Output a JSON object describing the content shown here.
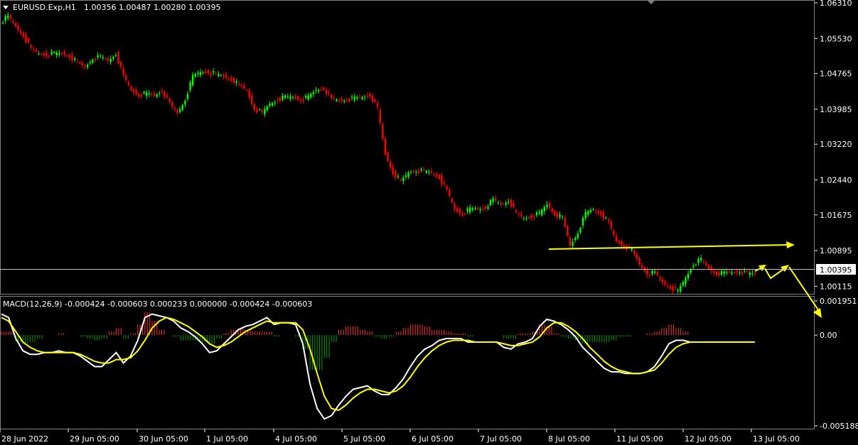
{
  "header": {
    "symbol": "EURUSD.Exp,H1",
    "ohlc": "1.00356 1.00487 1.00280 1.00395"
  },
  "indicator": {
    "label": "MACD(12,26,9) -0.000424 -0.000603 0.000233 0.000000 -0.000424 -0.000603"
  },
  "current_price": "1.00395",
  "colors": {
    "background": "#000000",
    "bull": "#00ff00",
    "bear": "#ff0000",
    "macd_line": "#ffffff",
    "signal_line": "#ffff00",
    "hist_pos": "#ff3030",
    "hist_neg": "#00a000",
    "annotation": "#ffff00",
    "grid": "#808080"
  },
  "chart_data": [
    {
      "type": "candlestick",
      "x_ticks": [
        "28 Jun 2022",
        "29 Jun 05:00",
        "30 Jun 05:00",
        "1 Jul 05:00",
        "4 Jul 05:00",
        "5 Jul 05:00",
        "6 Jul 05:00",
        "7 Jul 05:00",
        "8 Jul 05:00",
        "11 Jul 05:00",
        "12 Jul 05:00",
        "13 Jul 05:00"
      ],
      "y_ticks": [
        "1.06310",
        "1.05530",
        "1.04765",
        "1.03985",
        "1.03220",
        "1.02440",
        "1.01675",
        "1.00895",
        "1.00115"
      ],
      "ylim": [
        0.9995,
        1.0631
      ],
      "close_path": [
        1.059,
        1.06,
        1.058,
        1.056,
        1.053,
        1.052,
        1.0518,
        1.052,
        1.052,
        1.0515,
        1.05,
        1.049,
        1.051,
        1.0512,
        1.0505,
        1.052,
        1.047,
        1.044,
        1.043,
        1.0432,
        1.0428,
        1.044,
        1.041,
        1.039,
        1.042,
        1.047,
        1.048,
        1.048,
        1.0475,
        1.047,
        1.0465,
        1.045,
        1.044,
        1.04,
        1.039,
        1.041,
        1.042,
        1.0425,
        1.0425,
        1.042,
        1.0425,
        1.044,
        1.0445,
        1.042,
        1.0418,
        1.042,
        1.0422,
        1.0425,
        1.043,
        1.04,
        1.03,
        1.026,
        1.024,
        1.026,
        1.0265,
        1.0262,
        1.026,
        1.025,
        1.022,
        1.018,
        1.017,
        1.018,
        1.018,
        1.0185,
        1.02,
        1.019,
        1.02,
        1.017,
        1.016,
        1.0165,
        1.017,
        1.019,
        1.017,
        1.016,
        1.01,
        1.013,
        1.017,
        1.018,
        1.017,
        1.015,
        1.011,
        1.01,
        1.009,
        1.006,
        1.004,
        1.004,
        1.002,
        1.001,
        1.0,
        1.003,
        1.006,
        1.007,
        1.005,
        1.004,
        1.004,
        1.0042,
        1.0045,
        1.0039
      ]
    },
    {
      "type": "line",
      "name": "MACD(12,26,9)",
      "y_ticks": [
        "0.001951",
        "0.00",
        "-0.005188"
      ],
      "ylim": [
        -0.005188,
        0.001951
      ],
      "x_count": 106,
      "series": [
        {
          "values": [
            0.0012,
            0.001,
            -0.0002,
            -0.0009,
            -0.0011,
            -0.0011,
            -0.001,
            -0.001,
            -0.0009,
            -0.001,
            -0.001,
            -0.0012,
            -0.0015,
            -0.0018,
            -0.0018,
            -0.0014,
            -0.001,
            -0.0016,
            -0.0012,
            -0.0003,
            0.001,
            0.0012,
            0.0011,
            0.001,
            0.0008,
            0.0004,
            0.0002,
            -0.0001,
            -0.0005,
            -0.001,
            -0.0009,
            -0.0005,
            -0.0001,
            0.0003,
            0.0005,
            0.0006,
            0.0008,
            0.001,
            0.0006,
            0.0007,
            0.0007,
            0.0006,
            -0.0005,
            -0.0028,
            -0.0042,
            -0.0048,
            -0.0046,
            -0.004,
            -0.0035,
            -0.0031,
            -0.003,
            -0.0029,
            -0.0032,
            -0.0034,
            -0.0034,
            -0.003,
            -0.0025,
            -0.0018,
            -0.0012,
            -0.0008,
            -0.0006,
            -0.0003,
            -0.0002,
            -0.0002,
            -0.0002,
            -0.0004,
            -0.0004,
            -0.0004,
            -0.0004,
            -0.0004,
            -0.0007,
            -0.0008,
            -0.0005,
            -0.0004,
            -0.0002,
            0.0005,
            0.0009,
            0.0008,
            0.0006,
            0.0003,
            -0.0001,
            -0.0007,
            -0.0011,
            -0.0015,
            -0.0019,
            -0.0021,
            -0.0021,
            -0.0022,
            -0.0022,
            -0.0022,
            -0.0021,
            -0.0018,
            -0.0012,
            -0.0005,
            -0.0003,
            -0.0003,
            -0.0004,
            -0.0004,
            -0.0004,
            -0.0004,
            -0.0004,
            -0.0004,
            -0.0004,
            -0.0004,
            -0.0004,
            -0.0004
          ]
        },
        {
          "values": [
            0.001,
            0.0008,
            0.0002,
            -0.0004,
            -0.0007,
            -0.0009,
            -0.001,
            -0.001,
            -0.001,
            -0.001,
            -0.001,
            -0.0011,
            -0.0013,
            -0.0015,
            -0.0016,
            -0.0016,
            -0.0014,
            -0.0014,
            -0.0013,
            -0.0009,
            -0.0003,
            0.0004,
            0.0008,
            0.001,
            0.0009,
            0.0007,
            0.0005,
            0.0002,
            -0.0001,
            -0.0005,
            -0.0007,
            -0.0006,
            -0.0004,
            -0.0001,
            0.0002,
            0.0004,
            0.0006,
            0.0008,
            0.0007,
            0.0007,
            0.0007,
            0.0007,
            0.0003,
            -0.0008,
            -0.0022,
            -0.0035,
            -0.0042,
            -0.0043,
            -0.004,
            -0.0036,
            -0.0033,
            -0.0031,
            -0.0031,
            -0.0032,
            -0.0033,
            -0.0032,
            -0.0029,
            -0.0024,
            -0.0018,
            -0.0013,
            -0.0009,
            -0.0006,
            -0.0004,
            -0.0003,
            -0.0003,
            -0.0003,
            -0.0004,
            -0.0004,
            -0.0004,
            -0.0004,
            -0.0005,
            -0.0006,
            -0.0006,
            -0.0005,
            -0.0004,
            -0.0001,
            0.0004,
            0.0007,
            0.0007,
            0.0005,
            0.0002,
            -0.0002,
            -0.0007,
            -0.0011,
            -0.0015,
            -0.0018,
            -0.002,
            -0.0021,
            -0.0022,
            -0.0022,
            -0.0021,
            -0.002,
            -0.0016,
            -0.0011,
            -0.0007,
            -0.0005,
            -0.0004,
            -0.0004,
            -0.0004,
            -0.0004,
            -0.0004,
            -0.0004,
            -0.0004,
            -0.0004,
            -0.0004,
            -0.0004
          ]
        }
      ],
      "histogram": [
        0.0002,
        0.0002,
        -0.0004,
        -0.0005,
        -0.0004,
        -0.0002,
        0.0,
        0.0,
        0.0001,
        0.0,
        0.0,
        -0.0001,
        -0.0002,
        -0.0003,
        -0.0002,
        0.0002,
        0.0004,
        -0.0002,
        0.0001,
        0.0006,
        0.0013,
        0.0008,
        0.0003,
        0.0,
        -0.0001,
        -0.0003,
        -0.0003,
        -0.0003,
        -0.0004,
        -0.0005,
        -0.0002,
        0.0001,
        0.0003,
        0.0004,
        0.0003,
        0.0002,
        0.0002,
        0.0002,
        -0.0001,
        0.0,
        0.0,
        -0.0001,
        -0.0008,
        -0.002,
        -0.002,
        -0.0013,
        -0.0004,
        0.0003,
        0.0005,
        0.0005,
        0.0003,
        0.0002,
        -0.0001,
        -0.0002,
        -0.0001,
        0.0002,
        0.0004,
        0.0006,
        0.0006,
        0.0005,
        0.0003,
        0.0003,
        0.0002,
        0.0001,
        0.0001,
        -0.0001,
        0.0,
        0.0,
        0.0,
        0.0,
        -0.0002,
        -0.0002,
        0.0001,
        0.0001,
        0.0002,
        0.0006,
        0.0005,
        0.0001,
        -0.0001,
        -0.0002,
        -0.0003,
        -0.0005,
        -0.0004,
        -0.0004,
        -0.0004,
        -0.0003,
        -0.0001,
        -0.0001,
        0.0,
        0.0,
        0.0001,
        0.0002,
        0.0004,
        0.0006,
        0.0004,
        0.0002,
        0.0,
        0.0,
        0.0,
        0.0,
        0.0,
        0.0,
        0.0,
        0.0,
        0.0,
        0.0
      ]
    }
  ]
}
